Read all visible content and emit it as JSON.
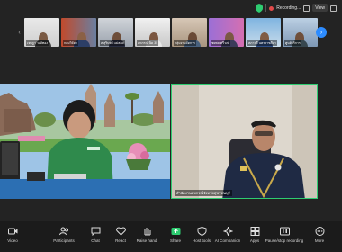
{
  "status": {
    "recording_label": "Recording...",
    "view_label": "View"
  },
  "gallery": {
    "tiles": [
      {
        "label": "เจษฎา วงษ์ทอง"
      },
      {
        "label": "กลุ่มวิจัยฯ"
      },
      {
        "label": "ส.สุรินทร์ แม่สอด"
      },
      {
        "label": "สหกรณ์ นิด 35"
      },
      {
        "label": "กลุ่มงานจัดการ"
      },
      {
        "label": "ชยพล ศรีวงษ์"
      },
      {
        "label": "สภาวดี นครราชสีมา"
      },
      {
        "label": "ศูนย์บริการ"
      }
    ]
  },
  "right_video": {
    "name": "สำนักงานสหกรณ์จังหวัดสุพรรณบุรี"
  },
  "toolbar": {
    "items": [
      {
        "label": "Video",
        "icon": "video-icon"
      },
      {
        "label": "Participants",
        "icon": "participants-icon"
      },
      {
        "label": "Chat",
        "icon": "chat-icon"
      },
      {
        "label": "React",
        "icon": "react-icon"
      },
      {
        "label": "Raise hand",
        "icon": "raise-hand-icon"
      },
      {
        "label": "Share",
        "icon": "share-icon"
      },
      {
        "label": "Host tools",
        "icon": "host-tools-icon"
      },
      {
        "label": "AI Companion",
        "icon": "ai-companion-icon"
      },
      {
        "label": "Apps",
        "icon": "apps-icon"
      },
      {
        "label": "Pause/stop recording",
        "icon": "pause-recording-icon"
      },
      {
        "label": "More",
        "icon": "more-icon"
      }
    ]
  },
  "colors": {
    "background": "#232323",
    "toolbar": "#1b1b1b",
    "active_speaker_border": "#2ecc71",
    "accent": "#2d8cff",
    "recording": "#e34b4b"
  }
}
